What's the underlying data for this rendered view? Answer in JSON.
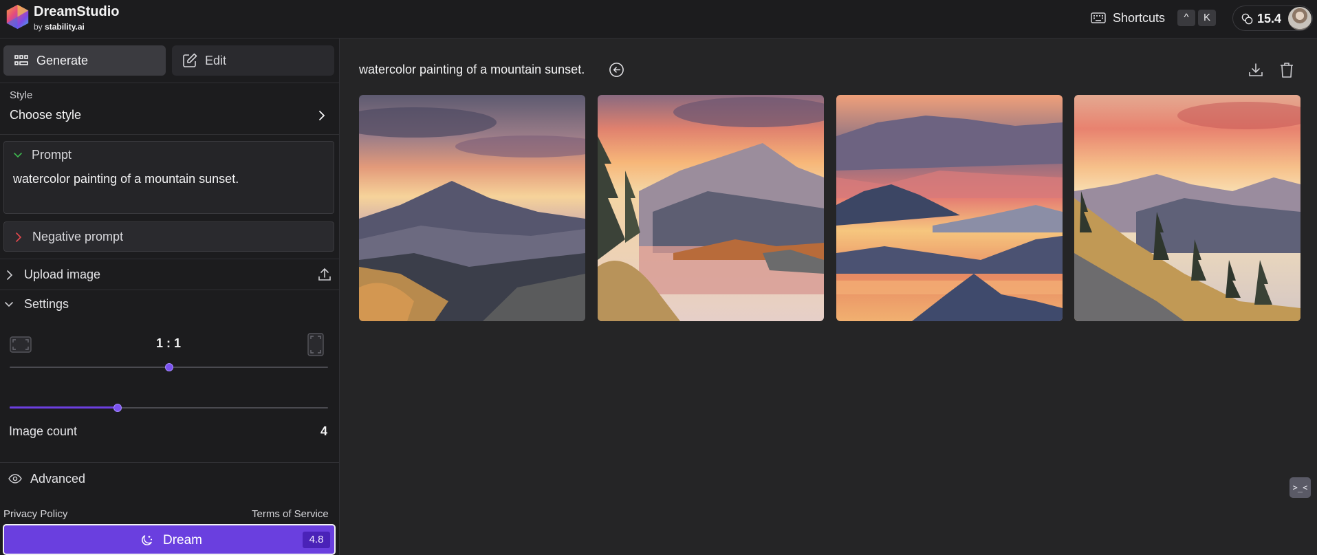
{
  "app": {
    "name": "DreamStudio",
    "by_prefix": "by",
    "by_brand": "stability.ai"
  },
  "header": {
    "shortcuts_label": "Shortcuts",
    "shortcut_keys": [
      "^",
      "K"
    ],
    "credits": "15.4",
    "icons": {
      "keyboard": "keyboard-icon",
      "credits": "credits-coin-icon",
      "avatar": "user-avatar"
    }
  },
  "sidebar": {
    "tabs": [
      {
        "label": "Generate",
        "icon": "grid-icon",
        "active": true
      },
      {
        "label": "Edit",
        "icon": "edit-icon",
        "active": false
      }
    ],
    "style": {
      "label": "Style",
      "value": "Choose style"
    },
    "prompt": {
      "title": "Prompt",
      "text": "watercolor painting of a mountain sunset."
    },
    "negative_prompt": {
      "title": "Negative prompt"
    },
    "upload_image": {
      "title": "Upload image"
    },
    "settings": {
      "title": "Settings",
      "aspect_ratio": "1 : 1",
      "aspect_ratio_slider": 0.5,
      "image_count_label": "Image count",
      "image_count": "4",
      "image_count_slider": 0.34
    },
    "advanced": "Advanced",
    "privacy_policy": "Privacy Policy",
    "terms_of_service": "Terms of Service",
    "dream_button": {
      "label": "Dream",
      "cost": "4.8"
    }
  },
  "main": {
    "prompt_title": "watercolor painting of a mountain sunset.",
    "images": [
      "watercolor-mountain-sunset-1",
      "watercolor-mountain-sunset-2",
      "watercolor-mountain-sunset-3",
      "watercolor-mountain-sunset-4"
    ]
  },
  "colors": {
    "accent": "#6a3fdf",
    "background": "#252526",
    "panel": "#1c1c1e"
  }
}
